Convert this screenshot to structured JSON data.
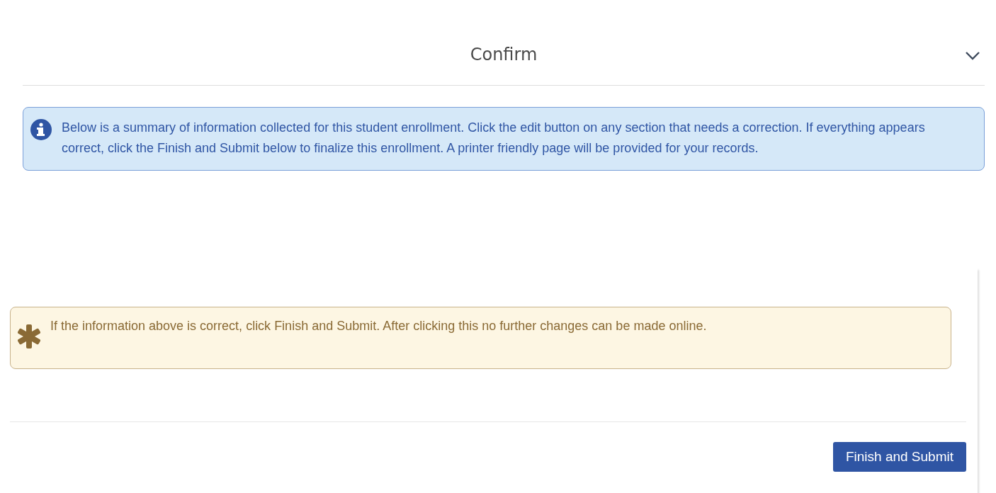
{
  "panel": {
    "title": "Confirm"
  },
  "info_alert": {
    "text": "Below is a summary of information collected for this student enrollment. Click the edit button on any section that needs a correction. If everything appears correct, click the Finish and Submit below to finalize this enrollment. A printer friendly page will be provided for your records."
  },
  "warning_alert": {
    "text": "If the information above is correct, click Finish and Submit. After clicking this no further changes can be made online."
  },
  "buttons": [
    "Finish and Submit"
  ]
}
